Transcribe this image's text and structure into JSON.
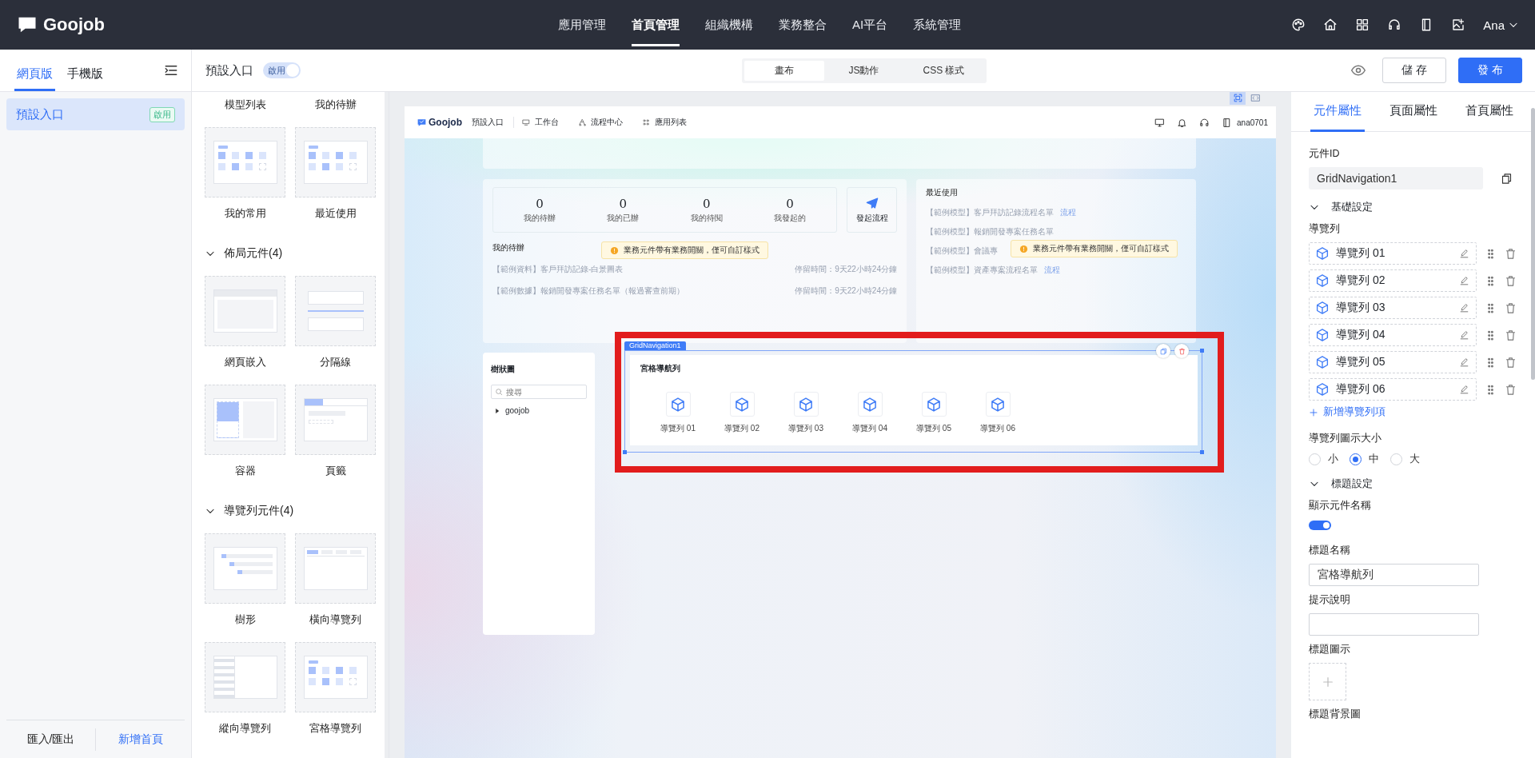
{
  "topbar": {
    "logo": "Goojob",
    "menu": [
      {
        "label": "應用管理",
        "selected": false
      },
      {
        "label": "首頁管理",
        "selected": true
      },
      {
        "label": "組織機構",
        "selected": false
      },
      {
        "label": "業務整合",
        "selected": false
      },
      {
        "label": "AI平台",
        "selected": false
      },
      {
        "label": "系統管理",
        "selected": false
      }
    ],
    "user": "Ana"
  },
  "toolbar": {
    "mode_tabs": [
      {
        "label": "網頁版",
        "selected": true
      },
      {
        "label": "手機版",
        "selected": false
      }
    ],
    "page_title": "預設入口",
    "toggle": {
      "label": "啟用",
      "on": true
    },
    "views": [
      {
        "label": "畫布",
        "selected": true
      },
      {
        "label": "JS動作",
        "selected": false
      },
      {
        "label": "CSS 樣式",
        "selected": false
      }
    ],
    "save": "儲 存",
    "publish": "發 布"
  },
  "sidebar": {
    "items": [
      {
        "label": "預設入口",
        "badge": "啟用",
        "selected": true
      }
    ],
    "footer": [
      "匯入/匯出",
      "新增首頁"
    ]
  },
  "components": {
    "top_labels": [
      "模型列表",
      "我的待辦"
    ],
    "cards": [
      {
        "label": "我的常用",
        "kind": "grid"
      },
      {
        "label": "最近使用",
        "kind": "grid"
      }
    ],
    "groups": [
      {
        "title": "佈局元件(4)",
        "expanded": true,
        "items": [
          {
            "label": "網頁嵌入",
            "kind": "code"
          },
          {
            "label": "分隔線",
            "kind": "divider"
          },
          {
            "label": "容器",
            "kind": "container"
          },
          {
            "label": "頁籤",
            "kind": "tabs"
          }
        ]
      },
      {
        "title": "導覽列元件(4)",
        "expanded": true,
        "items": [
          {
            "label": "樹形",
            "kind": "tree"
          },
          {
            "label": "橫向導覽列",
            "kind": "hnav"
          },
          {
            "label": "縱向導覽列",
            "kind": "vnav"
          },
          {
            "label": "宮格導覽列",
            "kind": "grid"
          }
        ]
      }
    ]
  },
  "canvas": {
    "view_modes": [
      {
        "selected": true
      },
      {
        "selected": false
      }
    ],
    "preview": {
      "logo": "Goojob",
      "page": "預設入口",
      "nav": [
        "工作台",
        "流程中心",
        "應用列表"
      ],
      "user": "ana0701",
      "stats": [
        {
          "value": "0",
          "label": "我的待辦"
        },
        {
          "value": "0",
          "label": "我的已辦"
        },
        {
          "value": "0",
          "label": "我的待閱"
        },
        {
          "value": "0",
          "label": "我發起的"
        }
      ],
      "action": "發起流程",
      "todo_title": "我的待辦",
      "todo": [
        {
          "text": "【範例資料】客戶拜訪記錄-白景圖表",
          "time": "停留時間：9天22小時24分鐘"
        },
        {
          "text": "【範例數據】報銷開發專案任務名單（報過審查前期）",
          "time": "停留時間：9天22小時24分鐘"
        }
      ],
      "tooltips": [
        "業務元件帶有業務開關，僅可自訂樣式",
        "業務元件帶有業務開關，僅可自訂樣式"
      ],
      "recent_title": "最近使用",
      "recent": [
        {
          "text": "【範例模型】客戶拜訪記錄流程名單",
          "link": "流程"
        },
        {
          "text": "【範例模型】報銷開發專案任務名單"
        },
        {
          "text": "【範例模型】會議專"
        },
        {
          "text": "【範例模型】資產專案流程名單",
          "link": "流程"
        }
      ],
      "tree": {
        "title": "樹狀圖",
        "placeholder": "搜尋",
        "nodes": [
          {
            "label": "goojob",
            "expanded": false
          }
        ]
      },
      "grid_nav": {
        "tag": "GridNavigation1",
        "title": "宮格導航列",
        "items": [
          "導覽列 01",
          "導覽列 02",
          "導覽列 03",
          "導覽列 04",
          "導覽列 05",
          "導覽列 06"
        ]
      }
    }
  },
  "properties": {
    "tabs": [
      {
        "label": "元件屬性",
        "selected": true
      },
      {
        "label": "頁面屬性",
        "selected": false
      },
      {
        "label": "首頁屬性",
        "selected": false
      }
    ],
    "id_label": "元件ID",
    "id_value": "GridNavigation1",
    "basic_section": {
      "title": "基礎設定",
      "expanded": true
    },
    "nav_label": "導覽列",
    "nav_items": [
      "導覽列 01",
      "導覽列 02",
      "導覽列 03",
      "導覽列 04",
      "導覽列 05",
      "導覽列 06"
    ],
    "add_item": "新增導覽列項",
    "size_label": "導覽列圖示大小",
    "sizes": [
      {
        "label": "小",
        "selected": false
      },
      {
        "label": "中",
        "selected": true
      },
      {
        "label": "大",
        "selected": false
      }
    ],
    "title_section": {
      "title": "標題設定",
      "expanded": true
    },
    "show_name": {
      "label": "顯示元件名稱",
      "on": true
    },
    "title_name": {
      "label": "標題名稱",
      "value": "宮格導航列"
    },
    "hint": {
      "label": "提示說明"
    },
    "title_icon_label": "標題圖示",
    "bg_label": "標題背景圖"
  }
}
